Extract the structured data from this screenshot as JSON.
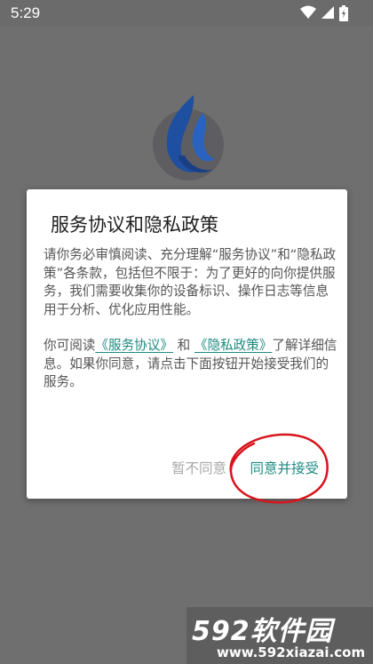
{
  "status_bar": {
    "time": "5:29",
    "icons": [
      "wifi-icon",
      "signal-icon",
      "battery-icon"
    ]
  },
  "splash": {
    "logo_icon": "flame-logo-icon",
    "logo_color": "#1f4fa0"
  },
  "dialog": {
    "title": "服务协议和隐私政策",
    "paragraph1": "请你务必审慎阅读、充分理解“服务协议”和“隐私政策”各条款，包括但不限于：为了更好的向你提供服务，我们需要收集你的设备标识、操作日志等信息用于分析、优化应用性能。",
    "paragraph2": {
      "prefix": "你可阅读",
      "service_link": "《服务协议》",
      "and_text": " 和 ",
      "privacy_link": "《隐私政策》",
      "suffix": "了解详细信息。如果你同意，请点击下面按钮开始接受我们的服务。"
    },
    "decline_label": "暂不同意",
    "accept_label": "同意并接受",
    "accent_color": "#1e8a80",
    "highlight_color": "#d8141c"
  },
  "watermark": {
    "logo_text": "592软件园",
    "url": "www.592xiazai.com"
  }
}
